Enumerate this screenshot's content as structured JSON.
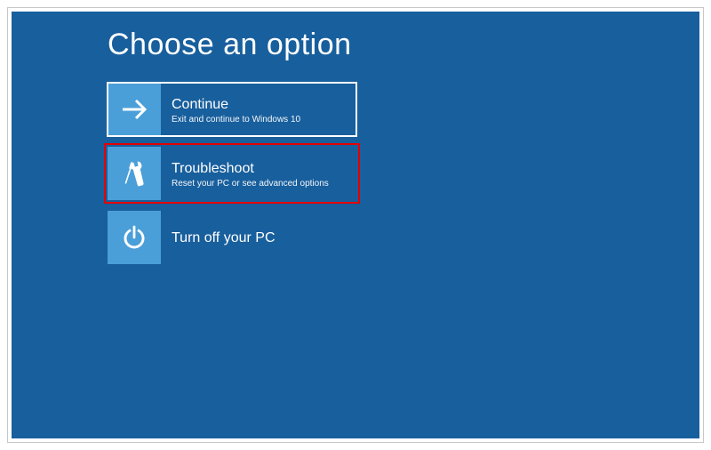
{
  "title": "Choose an option",
  "options": [
    {
      "title": "Continue",
      "desc": "Exit and continue to Windows 10",
      "selected": true,
      "highlighted": false
    },
    {
      "title": "Troubleshoot",
      "desc": "Reset your PC or see advanced options",
      "selected": false,
      "highlighted": true
    },
    {
      "title": "Turn off your PC",
      "desc": "",
      "selected": false,
      "highlighted": false
    }
  ]
}
